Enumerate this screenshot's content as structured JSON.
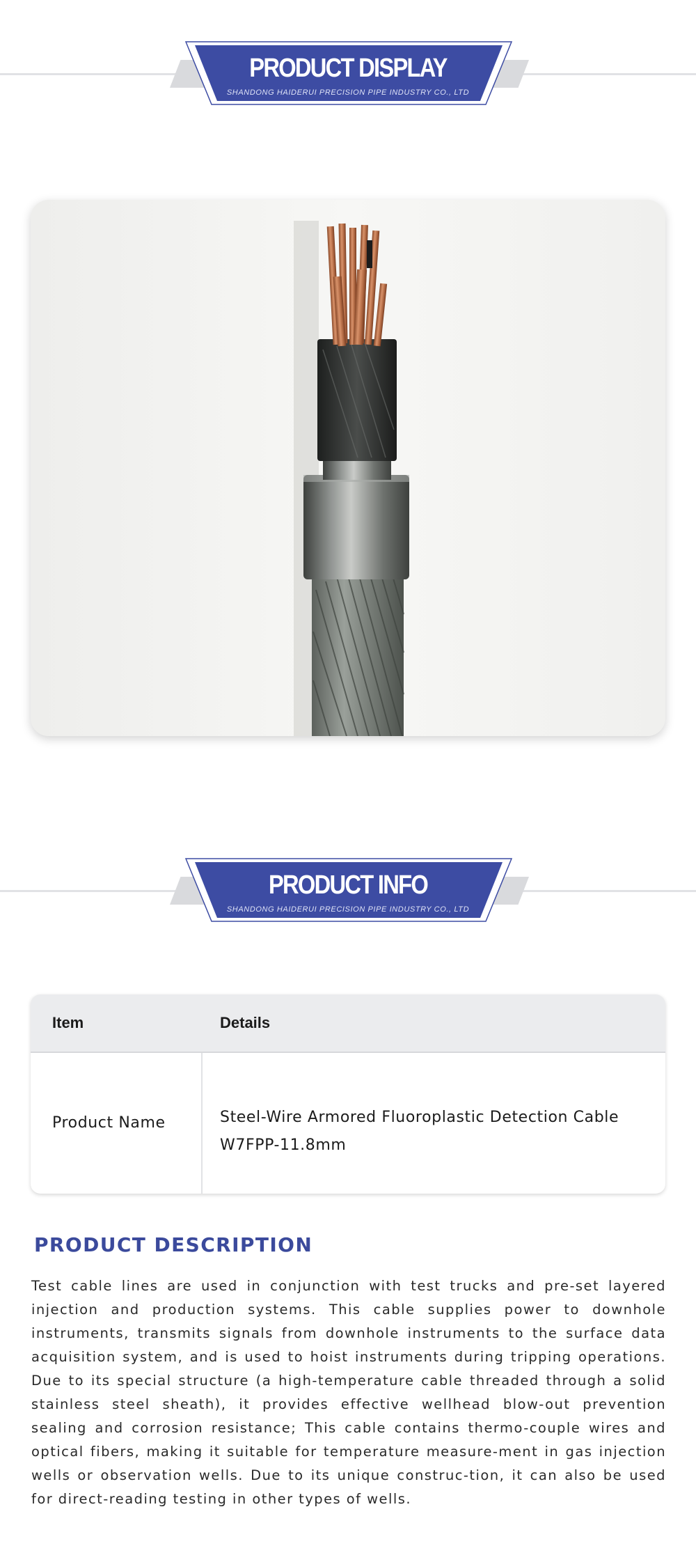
{
  "colors": {
    "brand_blue": "#3b4a9c",
    "banner_fill": "#3d4ca3",
    "table_header_bg": "#ebecee"
  },
  "display_banner": {
    "title": "PRODUCT DISPLAY",
    "subtitle": "SHANDONG HAIDERUI PRECISION PIPE INDUSTRY CO., LTD"
  },
  "photo": {
    "subject": "steel-wire armored cable cross-section"
  },
  "info_banner": {
    "title": "PRODUCT INFO",
    "subtitle": "SHANDONG HAIDERUI PRECISION PIPE INDUSTRY CO., LTD"
  },
  "table": {
    "headers": [
      "Item",
      "Details"
    ],
    "rows": [
      {
        "item": "Product Name",
        "details_line1": "Steel-Wire Armored Fluoroplastic Detection Cable",
        "details_line2": "W7FPP-11.8mm"
      }
    ]
  },
  "description": {
    "title": "PRODUCT DESCRIPTION",
    "body": "Test cable lines are used in conjunction with test trucks and pre-set layered injection and production systems. This cable supplies power to downhole instruments, transmits signals from downhole instruments to the surface data acquisition system, and is used to hoist instruments during tripping operations. Due to its special structure (a high-temperature cable threaded through a solid stainless steel sheath), it provides effective wellhead blow-out prevention sealing and corrosion resistance; This cable contains thermo-couple wires and optical fibers, making it suitable for temperature measure-ment in gas injection wells or observation wells. Due to its unique construc-tion, it can also be used for direct-reading testing in other types of wells."
  }
}
